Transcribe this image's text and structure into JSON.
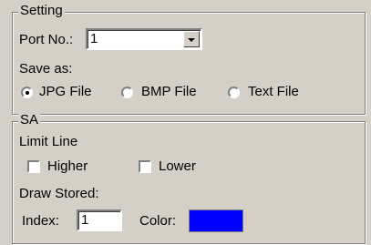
{
  "setting": {
    "legend": "Setting",
    "port_label": "Port No.:",
    "port_value": "1",
    "save_as_label": "Save as:",
    "save_options": [
      "JPG File",
      "BMP File",
      "Text File"
    ],
    "save_selected": "JPG File"
  },
  "sa": {
    "legend": "SA",
    "limit_line_label": "Limit Line",
    "higher_label": "Higher",
    "higher_checked": false,
    "lower_label": "Lower",
    "lower_checked": false,
    "draw_stored_label": "Draw Stored:",
    "index_label": "Index:",
    "index_value": "1",
    "color_label": "Color:",
    "color_value": "#0000ff"
  }
}
